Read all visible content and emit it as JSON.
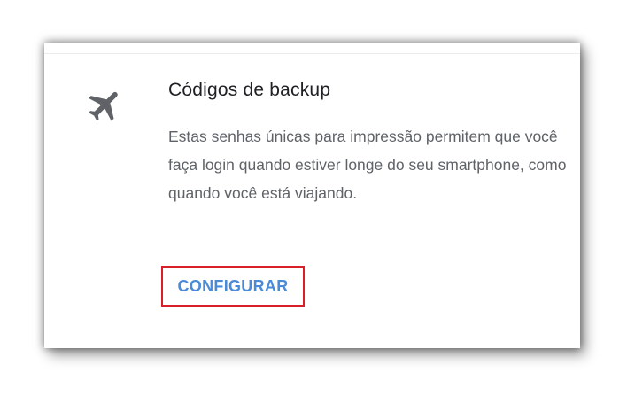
{
  "card": {
    "icon": "airplane-icon",
    "title": "Códigos de backup",
    "description": "Estas senhas únicas para impressão permitem que você faça login quando estiver longe do seu smartphone, como quando você está viajando.",
    "action_label": "CONFIGURAR"
  },
  "colors": {
    "title": "#202124",
    "description": "#5f6368",
    "action": "#4a8ad6",
    "highlight_border": "#d9202a",
    "icon": "#5f6368"
  }
}
